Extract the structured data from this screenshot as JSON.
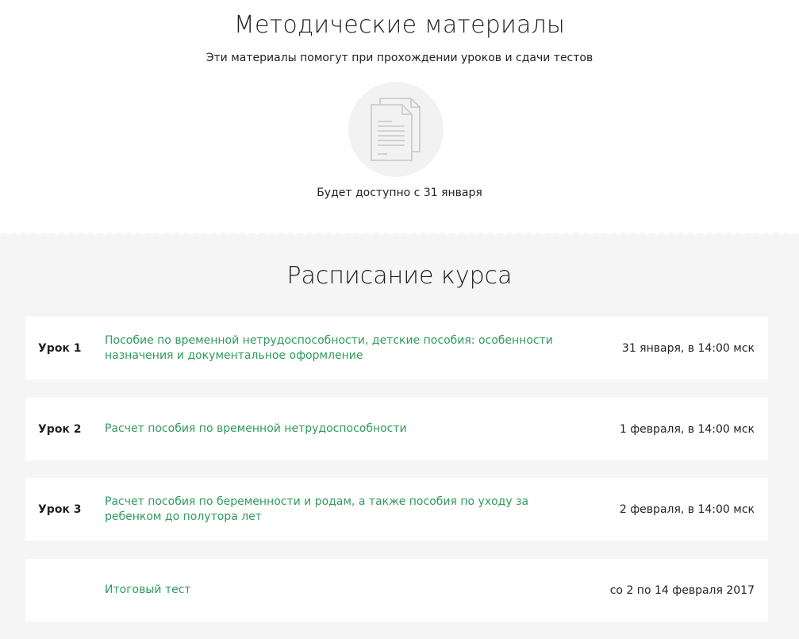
{
  "materials": {
    "title": "Методические материалы",
    "subtitle": "Эти материалы помогут при прохождении уроков и сдачи тестов",
    "icon": "documents-icon",
    "availability": "Будет доступно с 31 января"
  },
  "schedule": {
    "title": "Расписание курса",
    "rows": [
      {
        "lesson": "Урок 1",
        "topic": "Пособие по временной нетрудоспособности, детские пособия: особенности назначения и документальное оформление",
        "date": "31 января, в 14:00 мск"
      },
      {
        "lesson": "Урок 2",
        "topic": "Расчет пособия по временной нетрудоспособности",
        "date": "1 февраля, в 14:00 мск"
      },
      {
        "lesson": "Урок 3",
        "topic": "Расчет пособия по беременности и родам, а также пособия по уходу за ребенком до полутора лет",
        "date": "2 февраля, в 14:00 мск"
      },
      {
        "lesson": "",
        "topic": "Итоговый тест",
        "date": "со 2 по 14 февраля 2017"
      }
    ]
  },
  "colors": {
    "link": "#2f9a5e",
    "background_gray": "#f5f5f5",
    "circle": "#f2f2f2"
  }
}
